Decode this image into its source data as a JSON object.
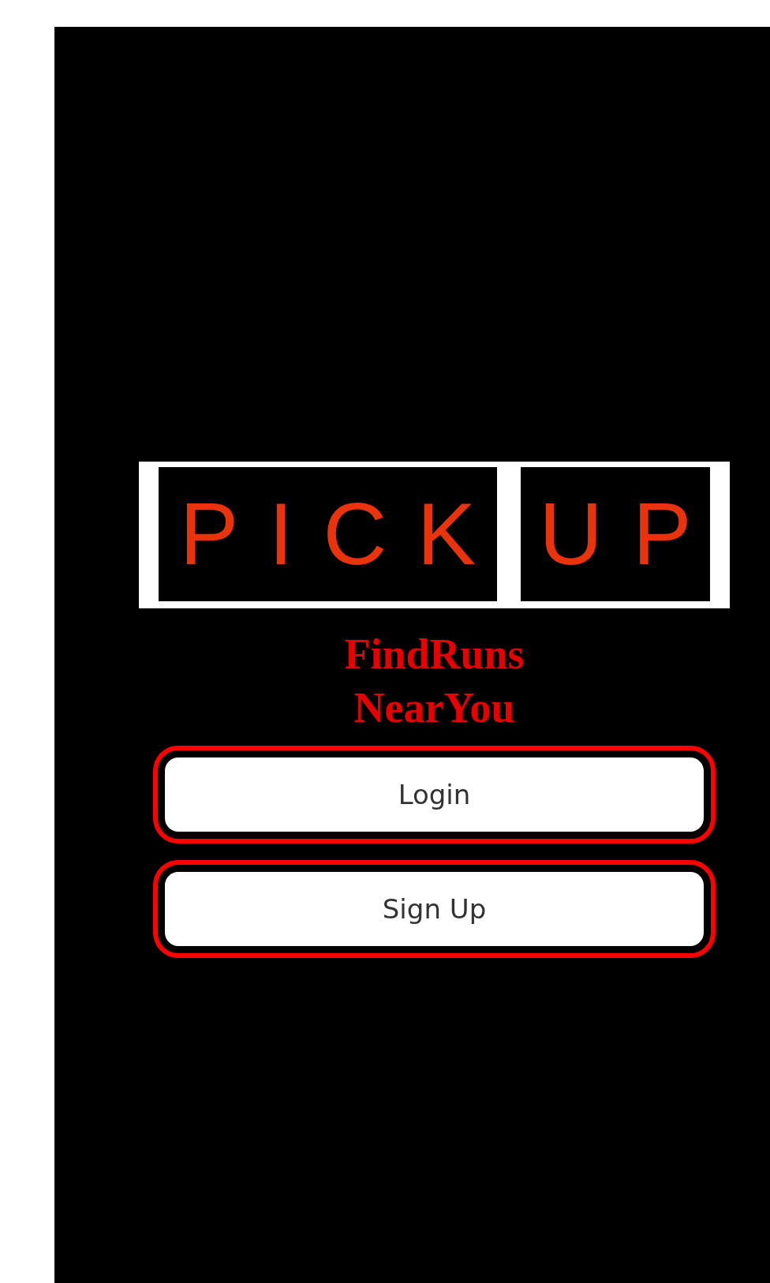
{
  "logo": {
    "words": [
      "PICK",
      "UP"
    ]
  },
  "tagline": [
    "FindRuns",
    "NearYou"
  ],
  "buttons": [
    {
      "label": "Login"
    },
    {
      "label": "Sign Up"
    }
  ]
}
